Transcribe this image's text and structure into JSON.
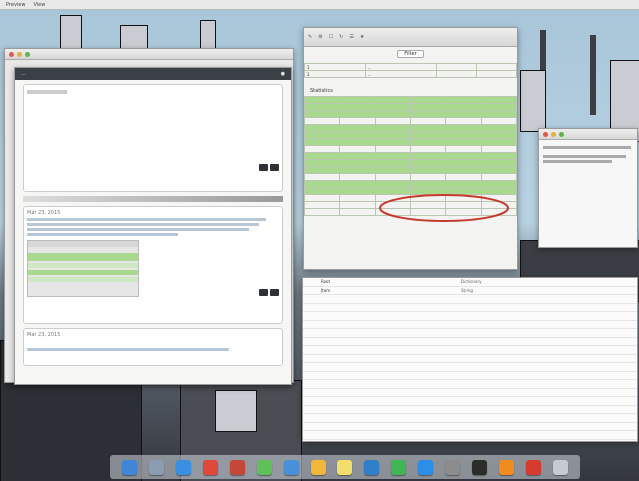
{
  "menubar": {
    "items": [
      "Preview",
      "View"
    ]
  },
  "chat_window": {
    "title": "...",
    "messages": [
      {
        "timestamp": "Mar 23, 2015",
        "text": "..."
      },
      {
        "timestamp": "Mar 23, 2015",
        "text": "..."
      }
    ]
  },
  "db_window": {
    "toolbar_button": "Filter",
    "top_table": {
      "rows": [
        [
          "1",
          "..."
        ],
        [
          "2",
          "..."
        ]
      ]
    },
    "section_label": "Statistics",
    "result_rows": 17,
    "highlighted_rows": [
      0,
      1,
      2,
      4,
      5,
      6,
      8,
      9,
      10,
      12,
      13
    ]
  },
  "plist_window": {
    "rows": [
      {
        "key": "Root",
        "type": "Dictionary",
        "value": ""
      },
      {
        "key": "Item",
        "type": "String",
        "value": ""
      }
    ]
  },
  "dock": {
    "icons": [
      "finder-icon",
      "launchpad-icon",
      "safari-icon",
      "chrome-icon",
      "photo-booth-icon",
      "messages-icon",
      "mail-icon",
      "photos-icon",
      "notes-icon",
      "xcode-icon",
      "spotify-icon",
      "app-store-icon",
      "system-preferences-icon",
      "terminal-icon",
      "vlc-icon",
      "filezilla-icon",
      "trash-icon"
    ],
    "colors": [
      "#3f87d6",
      "#8b9bb0",
      "#3b8fe0",
      "#e0483b",
      "#c4473a",
      "#5fc05a",
      "#4a90d9",
      "#f0b73b",
      "#f4de6b",
      "#2f7fc9",
      "#3fb653",
      "#2c8ee8",
      "#8c8c8c",
      "#2c2c2c",
      "#f08c1e",
      "#d63b2f",
      "#c7cbd1"
    ]
  }
}
